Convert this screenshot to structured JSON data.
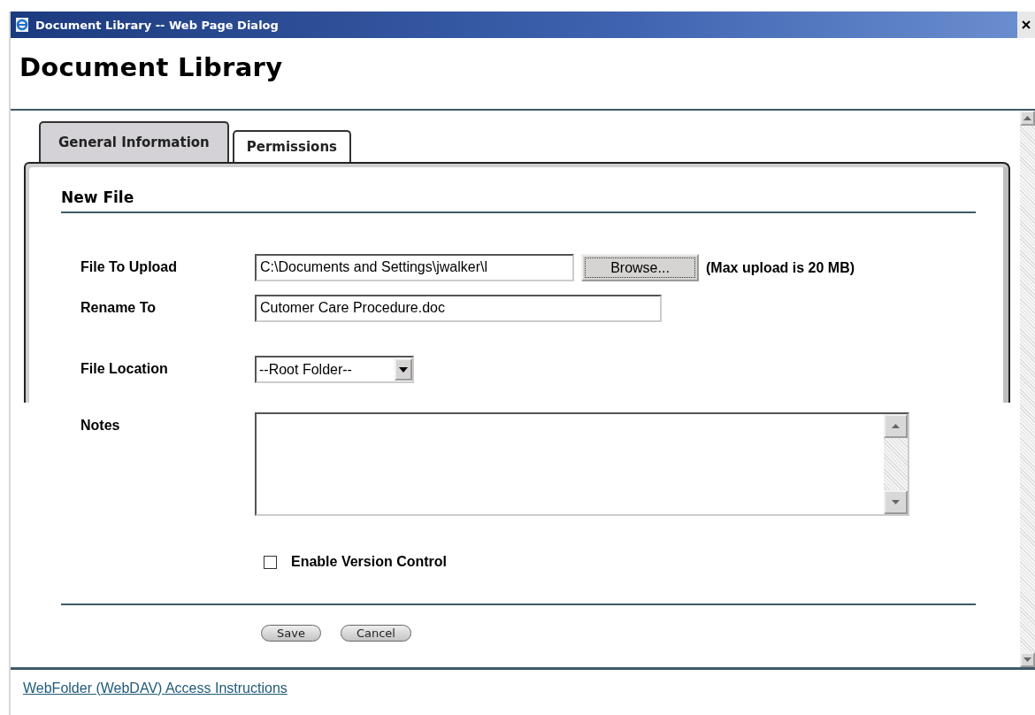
{
  "window": {
    "title": "Document Library -- Web Page Dialog"
  },
  "heading": "Document Library",
  "tabs": [
    {
      "label": "General Information",
      "selected": true
    },
    {
      "label": "Permissions",
      "selected": false
    }
  ],
  "section_title": "New File",
  "fields": [
    {
      "kind": "file",
      "label": "File To Upload",
      "value": "C:\\Documents and Settings\\jwalker\\l",
      "button": "Browse...",
      "note": "(Max upload is 20 MB)"
    },
    {
      "kind": "text",
      "label": "Rename To",
      "value": "Cutomer Care Procedure.doc"
    },
    {
      "kind": "select",
      "label": "File Location",
      "value": "--Root Folder--"
    },
    {
      "kind": "textarea",
      "label": "Notes"
    }
  ],
  "version_control": {
    "label": "Enable Version Control",
    "checked": false
  },
  "buttons": [
    "Save",
    "Cancel"
  ],
  "footer_link": "WebFolder (WebDAV) Access Instructions"
}
